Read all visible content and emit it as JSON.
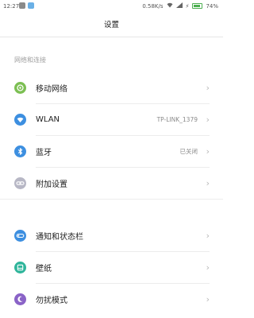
{
  "status_bar": {
    "time": "12:27",
    "speed": "0.58K/s",
    "battery": "74%"
  },
  "title": "设置",
  "section": "网络和连接",
  "items": [
    {
      "label": "移动网络",
      "value": "",
      "color": "#7cbf53",
      "icon": "mobile-network-icon"
    },
    {
      "label": "WLAN",
      "value": "TP-LINK_1379",
      "color": "#3d8fe0",
      "icon": "wifi-icon"
    },
    {
      "label": "蓝牙",
      "value": "已关闭",
      "color": "#3d8fe0",
      "icon": "bluetooth-icon"
    },
    {
      "label": "附加设置",
      "value": "",
      "color": "#b7b7c5",
      "icon": "link-icon"
    },
    {
      "label": "通知和状态栏",
      "value": "",
      "color": "#3d8fe0",
      "icon": "notification-toggle-icon"
    },
    {
      "label": "壁纸",
      "value": "",
      "color": "#2fb59b",
      "icon": "wallpaper-icon"
    },
    {
      "label": "勿扰模式",
      "value": "",
      "color": "#8a63c7",
      "icon": "moon-icon"
    }
  ]
}
